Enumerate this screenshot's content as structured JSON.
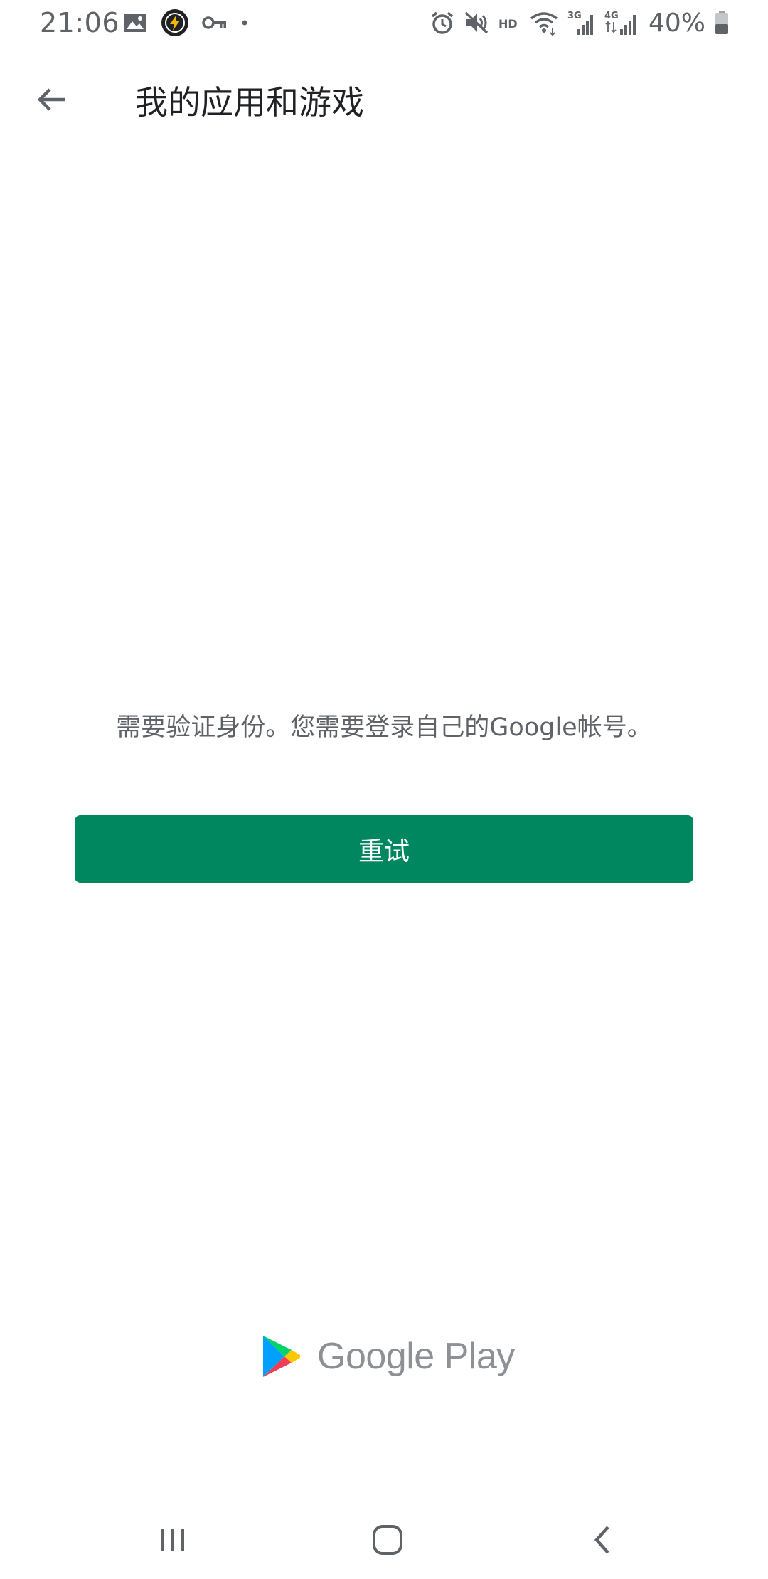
{
  "status_bar": {
    "time": "21:06",
    "battery": "40%",
    "left_icons": [
      "image-icon",
      "lightning-icon",
      "key-icon",
      "dot-icon"
    ],
    "right_icons": [
      "alarm-icon",
      "mute-icon",
      "hd-icon",
      "wifi-icon",
      "signal-3g-icon",
      "signal-4g-icon",
      "battery-icon"
    ]
  },
  "app_bar": {
    "title": "我的应用和游戏",
    "back_icon": "back-arrow-icon"
  },
  "content": {
    "message": "需要验证身份。您需要登录自己的Google帐号。",
    "retry_label": "重试"
  },
  "footer": {
    "brand": "Google Play",
    "brand_icon": "google-play-icon"
  },
  "nav_bar": {
    "icons": [
      "recents-icon",
      "home-icon",
      "nav-back-icon"
    ]
  },
  "colors": {
    "accent": "#01875f",
    "text_primary": "#202124",
    "text_secondary": "#5f6368",
    "wordmark": "#8d9196"
  }
}
